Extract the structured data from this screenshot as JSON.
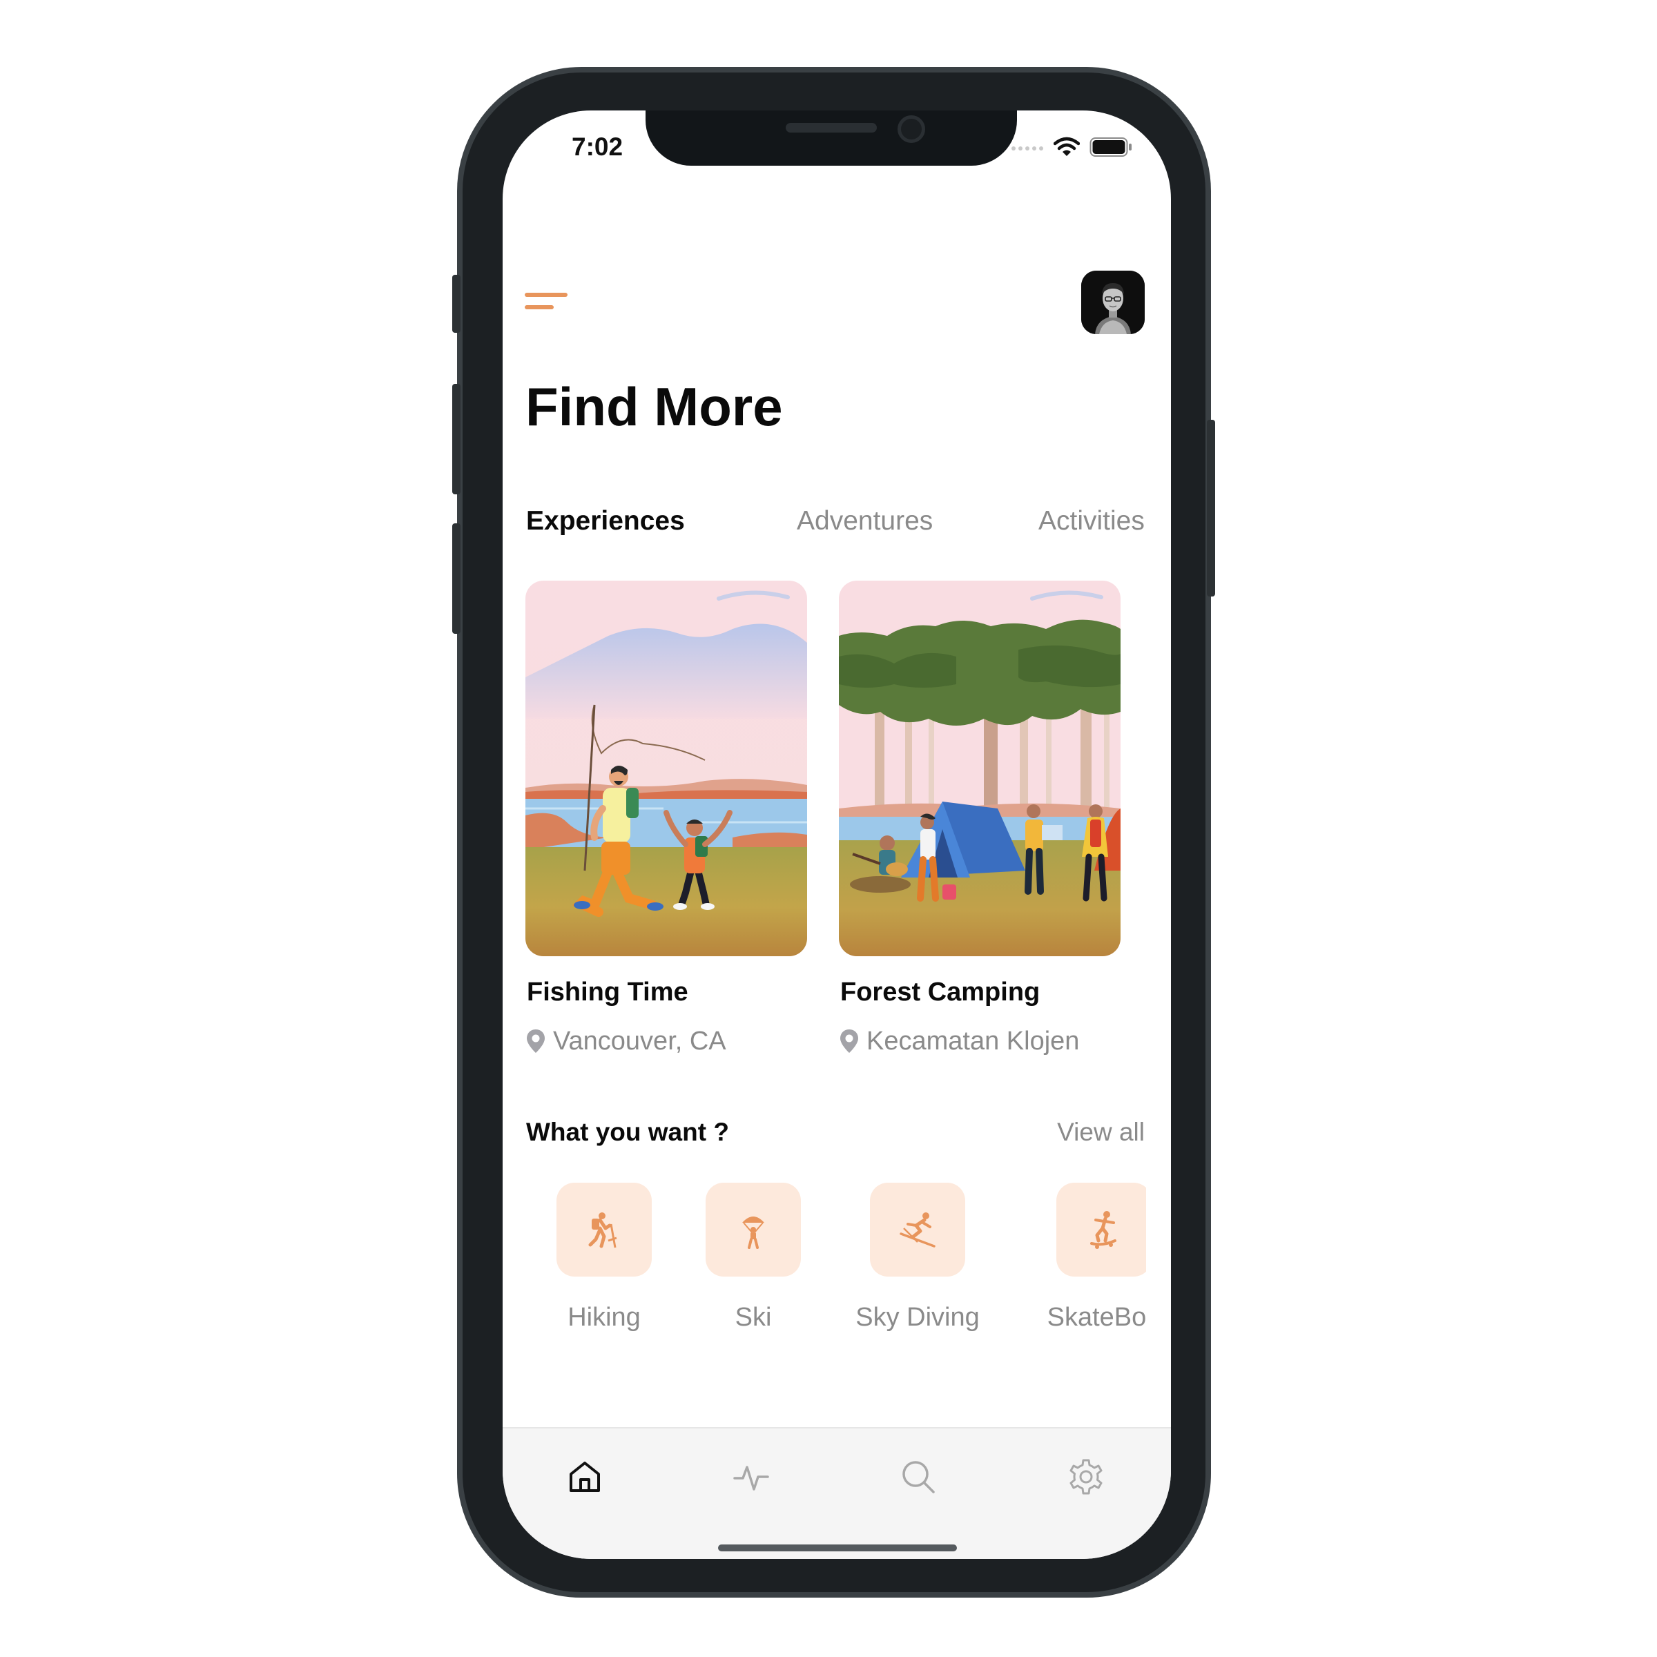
{
  "status_bar": {
    "time": "7:02"
  },
  "header": {
    "menu_icon": "hamburger-menu-icon",
    "avatar": "user-avatar",
    "title": "Find More"
  },
  "tabs": [
    {
      "label": "Experiences",
      "active": true
    },
    {
      "label": "Adventures",
      "active": false
    },
    {
      "label": "Activities",
      "active": false
    }
  ],
  "cards": [
    {
      "title": "Fishing Time",
      "location": "Vancouver, CA",
      "image": "fishing-illustration"
    },
    {
      "title": "Forest Camping",
      "location": "Kecamatan Klojen",
      "image": "camping-illustration"
    }
  ],
  "categories_section": {
    "title": "What you want ?",
    "view_all": "View all",
    "items": [
      {
        "label": "Hiking",
        "icon": "hiking-icon"
      },
      {
        "label": "Ski",
        "icon": "parachute-icon"
      },
      {
        "label": "Sky Diving",
        "icon": "skiing-icon"
      },
      {
        "label": "SkateBoa",
        "icon": "skateboard-icon"
      }
    ]
  },
  "tabbar": {
    "items": [
      {
        "icon": "home-icon",
        "active": true
      },
      {
        "icon": "activity-icon",
        "active": false
      },
      {
        "icon": "search-icon",
        "active": false
      },
      {
        "icon": "settings-icon",
        "active": false
      }
    ]
  },
  "colors": {
    "accent": "#e8955c",
    "category_bg": "#fde9dc",
    "muted_text": "#8a8a8a",
    "device_frame": "#1c2023"
  }
}
